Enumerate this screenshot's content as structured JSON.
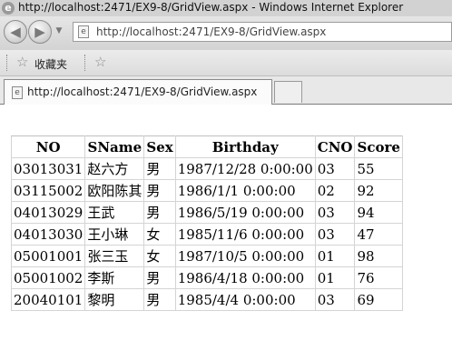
{
  "window": {
    "title": "http://localhost:2471/EX9-8/GridView.aspx - Windows Internet Explorer"
  },
  "navigation": {
    "back_glyph": "◀",
    "forward_glyph": "▶",
    "address": "http://localhost:2471/EX9-8/GridView.aspx"
  },
  "favorites_bar": {
    "label": "收藏夹"
  },
  "tabs": [
    {
      "label": "http://localhost:2471/EX9-8/GridView.aspx"
    }
  ],
  "grid": {
    "columns": [
      "NO",
      "SName",
      "Sex",
      "Birthday",
      "CNO",
      "Score"
    ],
    "rows": [
      [
        "03013031",
        "赵六方",
        "男",
        "1987/12/28 0:00:00",
        "03",
        "55"
      ],
      [
        "03115002",
        "欧阳陈其",
        "男",
        "1986/1/1 0:00:00",
        "02",
        "92"
      ],
      [
        "04013029",
        "王武",
        "男",
        "1986/5/19 0:00:00",
        "03",
        "94"
      ],
      [
        "04013030",
        "王小琳",
        "女",
        "1985/11/6 0:00:00",
        "03",
        "47"
      ],
      [
        "05001001",
        "张三玉",
        "女",
        "1987/10/5 0:00:00",
        "01",
        "98"
      ],
      [
        "05001002",
        "李斯",
        "男",
        "1986/4/18 0:00:00",
        "01",
        "76"
      ],
      [
        "20040101",
        "黎明",
        "男",
        "1985/4/4 0:00:00",
        "03",
        "69"
      ]
    ]
  }
}
